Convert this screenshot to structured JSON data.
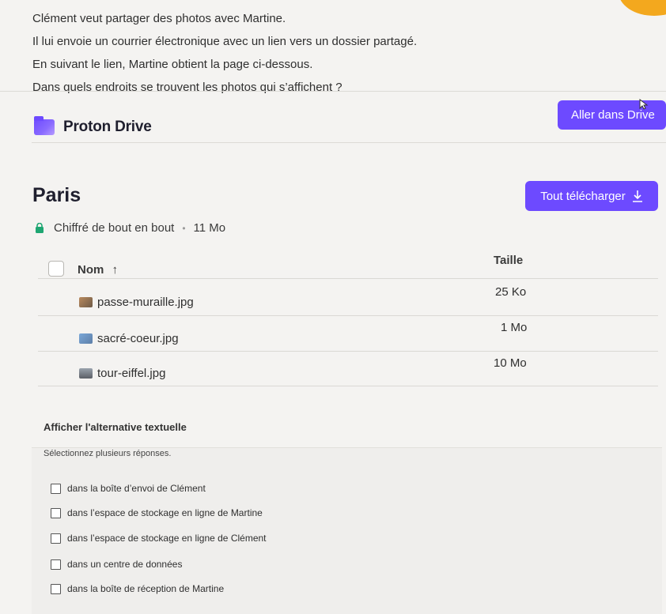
{
  "question": {
    "lines": [
      "Clément veut partager des photos avec Martine.",
      "Il lui envoie un courrier électronique avec un lien vers un dossier partagé.",
      "En suivant le lien, Martine obtient la page ci-dessous.",
      "Dans quels endroits se trouvent les photos qui s’affichent ?"
    ]
  },
  "app": {
    "brand": "Proton Drive",
    "go_drive_label": "Aller dans Drive",
    "accent": "#6d4aff"
  },
  "folder": {
    "title": "Paris",
    "download_label": "Tout télécharger",
    "encryption": "Chiffré de bout en bout",
    "total_size": "11 Mo"
  },
  "table": {
    "col_name": "Nom",
    "col_size": "Taille",
    "rows": [
      {
        "name": "passe-muraille.jpg",
        "size": "25 Ko"
      },
      {
        "name": "sacré-coeur.jpg",
        "size": "1 Mo"
      },
      {
        "name": "tour-eiffel.jpg",
        "size": "10 Mo"
      }
    ]
  },
  "alt_text_link": "Afficher l'alternative textuelle",
  "answers": {
    "instructions": "Sélectionnez plusieurs réponses.",
    "options": [
      "dans la boîte d’envoi de Clément",
      "dans l’espace de stockage en ligne de Martine",
      "dans l’espace de stockage en ligne de Clément",
      "dans un centre de données",
      "dans la boîte de réception de Martine"
    ]
  }
}
